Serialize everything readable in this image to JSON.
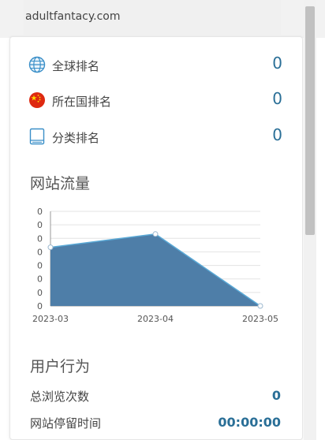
{
  "site": {
    "domain": "adultfantacy.com"
  },
  "ranks": [
    {
      "label": "全球排名",
      "value": "0",
      "icon": "globe-icon"
    },
    {
      "label": "所在国排名",
      "value": "0",
      "icon": "china-flag-icon"
    },
    {
      "label": "分类排名",
      "value": "0",
      "icon": "book-icon"
    }
  ],
  "traffic": {
    "title": "网站流量"
  },
  "chart_data": {
    "type": "area",
    "categories": [
      "2023-03",
      "2023-04",
      "2023-05"
    ],
    "values": [
      0.62,
      0.76,
      0
    ],
    "y_tick_labels": [
      "0",
      "0",
      "0",
      "0",
      "0",
      "0",
      "0",
      "0"
    ],
    "ylim": [
      0,
      1
    ],
    "grid": true,
    "colors": {
      "fill": "#4e7ea8",
      "line": "#5aa9d6",
      "point": "#ffffff"
    }
  },
  "behavior": {
    "title": "用户行为",
    "stats": [
      {
        "label": "总浏览次数",
        "value": "0"
      },
      {
        "label": "网站停留时间",
        "value": "00:00:00"
      }
    ]
  }
}
